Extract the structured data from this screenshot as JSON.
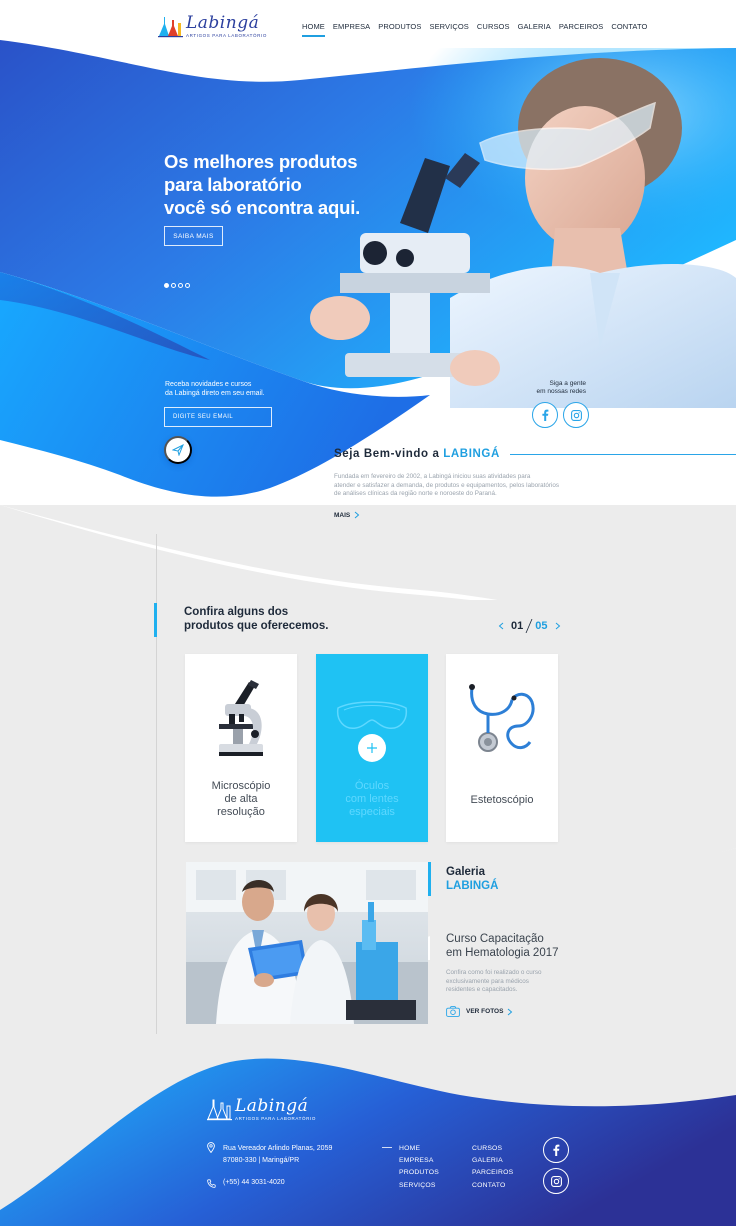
{
  "brand": {
    "name": "Labingá",
    "tagline": "ARTIGOS PARA LABORATÓRIO"
  },
  "nav": {
    "items": [
      {
        "label": "HOME",
        "active": true
      },
      {
        "label": "EMPRESA"
      },
      {
        "label": "PRODUTOS"
      },
      {
        "label": "SERVIÇOS"
      },
      {
        "label": "CURSOS"
      },
      {
        "label": "GALERIA"
      },
      {
        "label": "PARCEIROS"
      },
      {
        "label": "CONTATO"
      }
    ]
  },
  "hero": {
    "title_lines": [
      "Os melhores produtos",
      "para laboratório",
      "você só encontra aqui."
    ],
    "button": "SAIBA MAIS",
    "slides_total": 4,
    "slide_active": 1
  },
  "newsletter": {
    "text_lines": [
      "Receba novidades e cursos",
      "da Labingá direto em seu email."
    ],
    "email_placeholder": "DIGITE SEU EMAIL"
  },
  "social": {
    "text_lines": [
      "Siga a gente",
      "em nossas redes"
    ]
  },
  "welcome": {
    "title_prefix": "Seja Bem-vindo a",
    "title_brand": "LABINGÁ",
    "text_lines": [
      "Fundada em fevereiro de 2002, a Labingá iniciou suas atividades para",
      "atender e satisfazer a demanda, de produtos e equipamentos, pelos laboratórios",
      "de análises clínicas da região norte e noroeste do Paraná."
    ],
    "more": "MAIS"
  },
  "products": {
    "title_lines": [
      "Confira alguns dos",
      "produtos que oferecemos."
    ],
    "pager_current": "01",
    "pager_total": "05",
    "cards": [
      {
        "label_lines": [
          "Microscópio",
          "de alta",
          "resolução"
        ],
        "icon": "microscope-icon"
      },
      {
        "label_lines": [
          "Óculos",
          "com lentes",
          "especiais"
        ],
        "icon": "goggles-icon",
        "highlighted": true
      },
      {
        "label_lines": [
          "Estetoscópio"
        ],
        "icon": "stethoscope-icon"
      }
    ]
  },
  "gallery": {
    "title_line1": "Galeria",
    "title_line2": "LABINGÁ",
    "subtitle_lines": [
      "Curso Capacitação",
      "em Hematologia 2017"
    ],
    "text_lines": [
      "Confira como foi realizado o curso",
      "exclusivamente para médicos",
      "residentes e capacitados."
    ],
    "link": "VER FOTOS"
  },
  "footer": {
    "address_lines": [
      "Rua Vereador Arlindo Planas, 2059",
      "87080-330 | Maringá/PR"
    ],
    "phone": "(+55) 44 3031-4020",
    "links_col1": [
      "HOME",
      "EMPRESA",
      "PRODUTOS",
      "SERVIÇOS"
    ],
    "links_col2": [
      "CURSOS",
      "GALERIA",
      "PARCEIROS",
      "CONTATO"
    ]
  },
  "colors": {
    "brand_blue": "#2b3f9e",
    "accent_cyan": "#1f9fe0",
    "card_highlight": "#1fc2f3",
    "hero_gradient_start": "#1fb8ff",
    "hero_gradient_end": "#2c3fa8"
  }
}
